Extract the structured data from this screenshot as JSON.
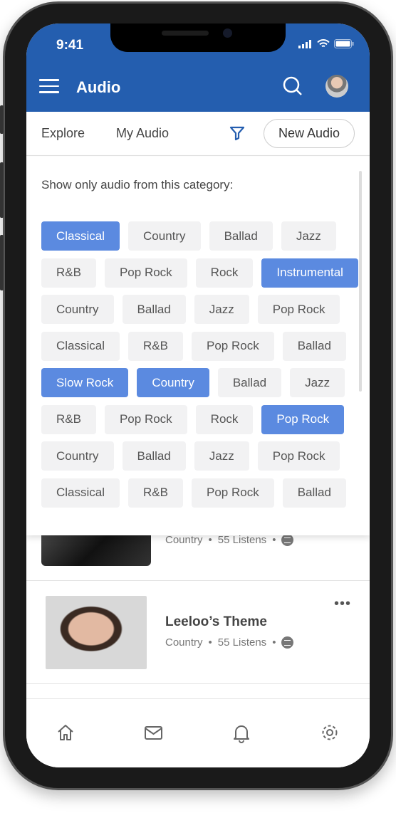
{
  "status": {
    "time": "9:41"
  },
  "header": {
    "title": "Audio"
  },
  "tabs": {
    "explore": "Explore",
    "my_audio": "My Audio",
    "new_audio": "New Audio"
  },
  "filter": {
    "prompt": "Show only audio from this category:",
    "rows": [
      [
        {
          "label": "Classical",
          "selected": true
        },
        {
          "label": "Country"
        },
        {
          "label": "Ballad"
        },
        {
          "label": "Jazz"
        }
      ],
      [
        {
          "label": "R&B"
        },
        {
          "label": "Pop Rock"
        },
        {
          "label": "Rock"
        },
        {
          "label": "Instrumental",
          "selected": true
        }
      ],
      [
        {
          "label": "Country"
        },
        {
          "label": "Ballad"
        },
        {
          "label": "Jazz"
        },
        {
          "label": "Pop Rock"
        }
      ],
      [
        {
          "label": "Classical"
        },
        {
          "label": "R&B"
        },
        {
          "label": "Pop Rock"
        },
        {
          "label": "Ballad"
        }
      ],
      [
        {
          "label": "Slow Rock",
          "selected": true
        },
        {
          "label": "Country",
          "selected": true
        },
        {
          "label": "Ballad"
        },
        {
          "label": "Jazz"
        }
      ],
      [
        {
          "label": "R&B"
        },
        {
          "label": "Pop Rock"
        },
        {
          "label": "Rock"
        },
        {
          "label": "Pop Rock",
          "selected": true
        }
      ],
      [
        {
          "label": "Country"
        },
        {
          "label": "Ballad"
        },
        {
          "label": "Jazz"
        },
        {
          "label": "Pop Rock"
        }
      ],
      [
        {
          "label": "Classical"
        },
        {
          "label": "R&B"
        },
        {
          "label": "Pop Rock"
        },
        {
          "label": "Ballad"
        }
      ]
    ]
  },
  "list": [
    {
      "genre": "Country",
      "listens": "55 Listens"
    },
    {
      "title": "Leeloo’s Theme",
      "genre": "Country",
      "listens": "55 Listens"
    }
  ],
  "nav": [
    "home-icon",
    "mail-icon",
    "bell-icon",
    "gear-icon"
  ],
  "colors": {
    "header": "#245eaf",
    "selected_chip": "#5b8ae0",
    "chip": "#f2f2f3"
  }
}
